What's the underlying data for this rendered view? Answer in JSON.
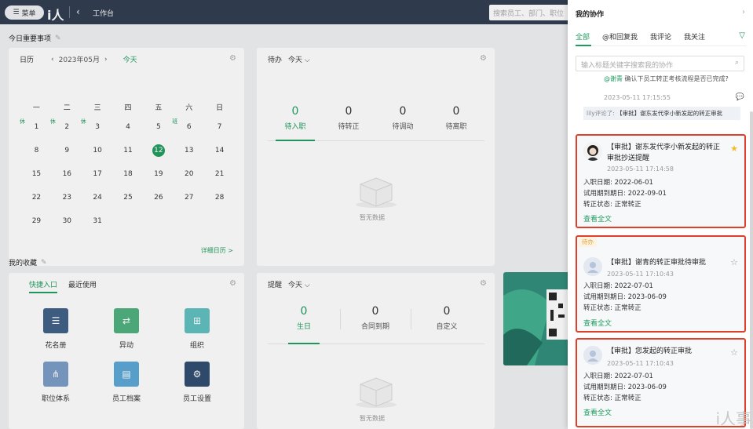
{
  "topbar": {
    "menu_label": "菜单",
    "logo": "i人",
    "breadcrumb": "工作台",
    "search_placeholder": "搜索员工、部门、职位"
  },
  "important": {
    "title": "今日重要事项"
  },
  "calendar": {
    "label": "日历",
    "month": "2023年05月",
    "today": "今天",
    "weekdays": [
      "一",
      "二",
      "三",
      "四",
      "五",
      "六",
      "日"
    ],
    "rows": [
      [
        "1",
        "2",
        "3",
        "4",
        "5",
        "6",
        "7"
      ],
      [
        "8",
        "9",
        "10",
        "11",
        "12",
        "13",
        "14"
      ],
      [
        "15",
        "16",
        "17",
        "18",
        "19",
        "20",
        "21"
      ],
      [
        "22",
        "23",
        "24",
        "25",
        "26",
        "27",
        "28"
      ],
      [
        "29",
        "30",
        "31",
        "",
        "",
        "",
        ""
      ]
    ],
    "tags": [
      "休",
      "休",
      "休",
      "班"
    ],
    "detail": "详细日历 >"
  },
  "todo": {
    "label": "待办",
    "range": "今天",
    "stats": [
      {
        "num": "0",
        "label": "待入职"
      },
      {
        "num": "0",
        "label": "待转正"
      },
      {
        "num": "0",
        "label": "待调动"
      },
      {
        "num": "0",
        "label": "待离职"
      }
    ],
    "empty": "暂无数据"
  },
  "favorites": {
    "title": "我的收藏",
    "tabs": [
      "快捷入口",
      "最近使用"
    ],
    "items": [
      "花名册",
      "异动",
      "组织",
      "职位体系",
      "员工档案",
      "员工设置"
    ]
  },
  "reminder": {
    "label": "提醒",
    "range": "今天",
    "stats": [
      {
        "num": "0",
        "label": "生日"
      },
      {
        "num": "0",
        "label": "合同到期"
      },
      {
        "num": "0",
        "label": "自定义"
      }
    ],
    "empty": "暂无数据"
  },
  "panel": {
    "title": "我的协作",
    "tabs": [
      "全部",
      "@和回复我",
      "我评论",
      "我关注"
    ],
    "search_placeholder": "输入标题关键字搜索我的协作",
    "prev": {
      "mention": "@谢青",
      "text": "确认下员工转正考核流程是否已完成?",
      "time": "2023-05-11 17:15:55",
      "comment_user": "lily评论了:",
      "comment_text": "【审批】谢东发代李小新发起的转正审批"
    },
    "feeds": [
      {
        "title": "【审批】谢东发代李小新发起的转正审批抄送提醒",
        "time": "2023-05-11 17:14:58",
        "fields": [
          "入职日期:  2022-06-01",
          "试用期到期日:  2022-09-01",
          "转正状态:  正常转正"
        ],
        "more": "查看全文"
      },
      {
        "badge": "待办",
        "title": "【审批】谢青的转正审批待审批",
        "time": "2023-05-11 17:10:43",
        "fields": [
          "入职日期:  2022-07-01",
          "试用期到期日:  2023-06-09",
          "转正状态:  正常转正"
        ],
        "more": "查看全文"
      },
      {
        "title": "【审批】您发起的转正审批",
        "time": "2023-05-11 17:10:43",
        "fields": [
          "入职日期:  2022-07-01",
          "试用期到期日:  2023-06-09",
          "转正状态:  正常转正"
        ],
        "more": "查看全文"
      }
    ]
  },
  "watermark": "i人事"
}
